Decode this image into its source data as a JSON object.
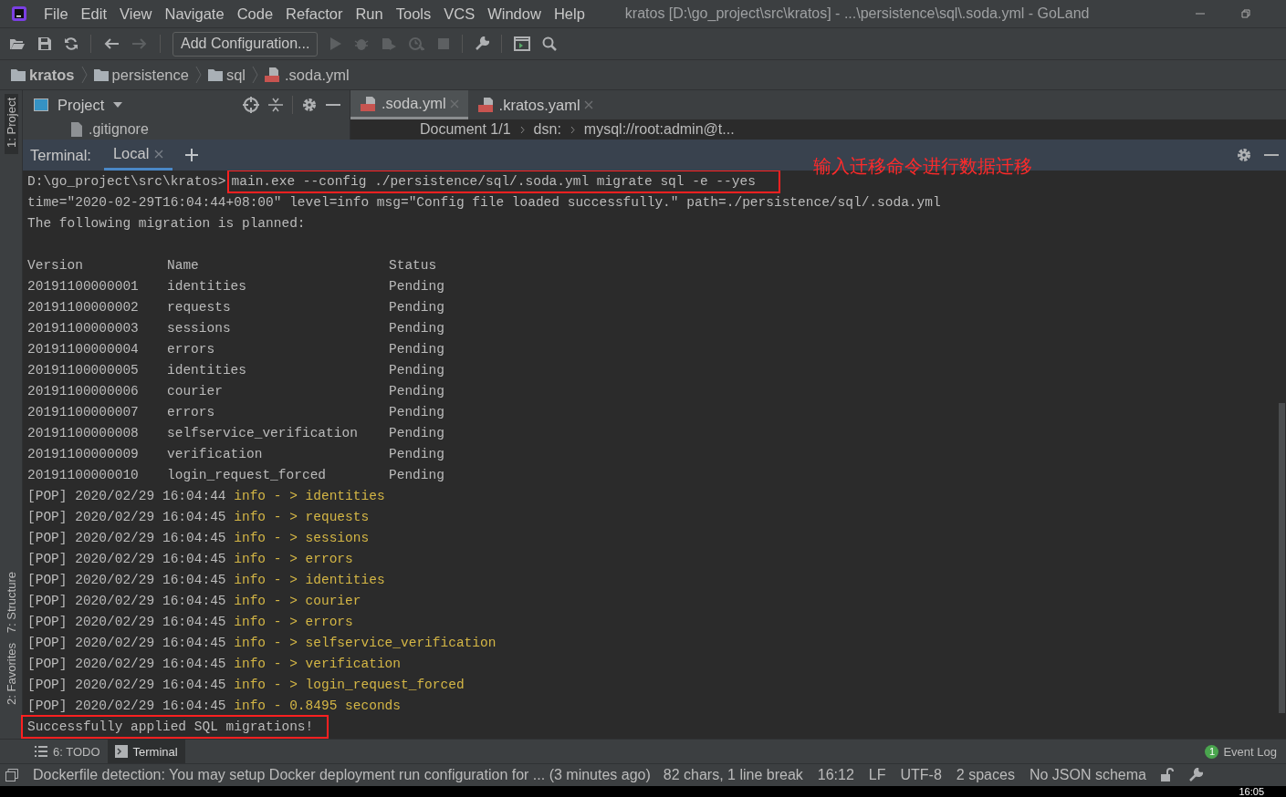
{
  "menu": [
    "File",
    "Edit",
    "View",
    "Navigate",
    "Code",
    "Refactor",
    "Run",
    "Tools",
    "VCS",
    "Window",
    "Help"
  ],
  "window_title": "kratos [D:\\go_project\\src\\kratos] - ...\\persistence\\sql\\.soda.yml - GoLand",
  "toolbar": {
    "run_config": "Add Configuration..."
  },
  "breadcrumb": [
    {
      "label": "kratos",
      "kind": "project"
    },
    {
      "label": "persistence",
      "kind": "folder"
    },
    {
      "label": "sql",
      "kind": "folder"
    },
    {
      "label": ".soda.yml",
      "kind": "file"
    }
  ],
  "side_tabs": [
    {
      "label": "1: Project",
      "selected": true
    },
    {
      "label": "7: Structure",
      "selected": false
    },
    {
      "label": "2: Favorites",
      "selected": false
    }
  ],
  "project_panel": {
    "title": "Project",
    "items": [
      ".gitignore"
    ]
  },
  "editor_tabs": [
    {
      "label": ".soda.yml",
      "selected": true
    },
    {
      "label": ".kratos.yaml",
      "selected": false
    }
  ],
  "editor_breadcrumb": [
    "Document 1/1",
    "dsn:",
    "mysql://root:admin@t..."
  ],
  "terminal": {
    "title": "Terminal:",
    "tabs": [
      {
        "label": "Local",
        "selected": true
      }
    ],
    "annotation": "输入迁移命令进行数据迁移",
    "lines": [
      {
        "kind": "prompt",
        "prompt": "D:\\go_project\\src\\kratos>",
        "text": "main.exe --config ./persistence/sql/.soda.yml migrate sql -e --yes",
        "highlighted": true
      },
      {
        "kind": "plain",
        "text": "time=\"2020-02-29T16:04:44+08:00\" level=info msg=\"Config file loaded successfully.\" path=./persistence/sql/.soda.yml",
        "highlighted": false
      },
      {
        "kind": "plain",
        "text": "The following migration is planned:",
        "highlighted": false
      },
      {
        "kind": "blank"
      },
      {
        "kind": "row",
        "cells": [
          "Version",
          "Name",
          "Status"
        ]
      },
      {
        "kind": "row",
        "cells": [
          "20191100000001",
          "identities",
          "Pending"
        ]
      },
      {
        "kind": "row",
        "cells": [
          "20191100000002",
          "requests",
          "Pending"
        ]
      },
      {
        "kind": "row",
        "cells": [
          "20191100000003",
          "sessions",
          "Pending"
        ]
      },
      {
        "kind": "row",
        "cells": [
          "20191100000004",
          "errors",
          "Pending"
        ]
      },
      {
        "kind": "row",
        "cells": [
          "20191100000005",
          "identities",
          "Pending"
        ]
      },
      {
        "kind": "row",
        "cells": [
          "20191100000006",
          "courier",
          "Pending"
        ]
      },
      {
        "kind": "row",
        "cells": [
          "20191100000007",
          "errors",
          "Pending"
        ]
      },
      {
        "kind": "row",
        "cells": [
          "20191100000008",
          "selfservice_verification",
          "Pending"
        ]
      },
      {
        "kind": "row",
        "cells": [
          "20191100000009",
          "verification",
          "Pending"
        ]
      },
      {
        "kind": "row",
        "cells": [
          "20191100000010",
          "login_request_forced",
          "Pending"
        ]
      },
      {
        "kind": "pop",
        "prefix": "[POP] 2020/02/29 16:04:44",
        "text": "info - > identities"
      },
      {
        "kind": "pop",
        "prefix": "[POP] 2020/02/29 16:04:45",
        "text": "info - > requests"
      },
      {
        "kind": "pop",
        "prefix": "[POP] 2020/02/29 16:04:45",
        "text": "info - > sessions"
      },
      {
        "kind": "pop",
        "prefix": "[POP] 2020/02/29 16:04:45",
        "text": "info - > errors"
      },
      {
        "kind": "pop",
        "prefix": "[POP] 2020/02/29 16:04:45",
        "text": "info - > identities"
      },
      {
        "kind": "pop",
        "prefix": "[POP] 2020/02/29 16:04:45",
        "text": "info - > courier"
      },
      {
        "kind": "pop",
        "prefix": "[POP] 2020/02/29 16:04:45",
        "text": "info - > errors"
      },
      {
        "kind": "pop",
        "prefix": "[POP] 2020/02/29 16:04:45",
        "text": "info - > selfservice_verification"
      },
      {
        "kind": "pop",
        "prefix": "[POP] 2020/02/29 16:04:45",
        "text": "info - > verification"
      },
      {
        "kind": "pop",
        "prefix": "[POP] 2020/02/29 16:04:45",
        "text": "info - > login_request_forced"
      },
      {
        "kind": "pop",
        "prefix": "[POP] 2020/02/29 16:04:45",
        "text": "info - 0.8495 seconds"
      },
      {
        "kind": "plain",
        "text": "Successfully applied SQL migrations!",
        "highlighted": true
      }
    ]
  },
  "bottom_tabs": [
    {
      "label": "6: TODO",
      "selected": false
    },
    {
      "label": "Terminal",
      "selected": true
    }
  ],
  "event_log": {
    "count": "1",
    "label": "Event Log"
  },
  "status_bar": {
    "message": "Dockerfile detection: You may setup Docker deployment run configuration for ... (3 minutes ago)",
    "items": [
      "82 chars, 1 line break",
      "16:12",
      "LF",
      "UTF-8",
      "2 spaces",
      "No JSON schema"
    ]
  },
  "taskbar": {
    "clock": "16:05"
  }
}
